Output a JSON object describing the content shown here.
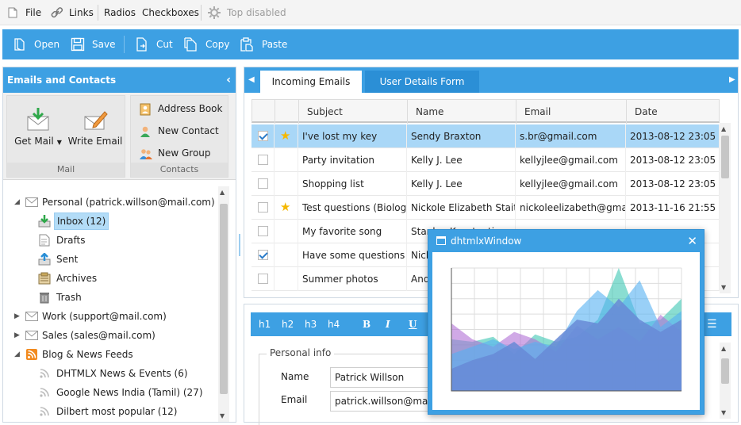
{
  "menubar": {
    "file": "File",
    "links": "Links",
    "radios": "Radios",
    "checkboxes": "Checkboxes",
    "top_disabled": "Top disabled"
  },
  "toolbar": {
    "open": "Open",
    "save": "Save",
    "cut": "Cut",
    "copy": "Copy",
    "paste": "Paste"
  },
  "left_panel": {
    "title": "Emails and Contacts",
    "ribbon": {
      "mail_group": "Mail",
      "contacts_group": "Contacts",
      "get_mail": "Get Mail",
      "write_email": "Write Email",
      "address_book": "Address Book",
      "new_contact": "New Contact",
      "new_group": "New Group"
    },
    "tree": [
      {
        "label": "Personal (patrick.willson@mail.com)"
      },
      {
        "label": "Inbox (12)"
      },
      {
        "label": "Drafts"
      },
      {
        "label": "Sent"
      },
      {
        "label": "Archives"
      },
      {
        "label": "Trash"
      },
      {
        "label": "Work (support@mail.com)"
      },
      {
        "label": "Sales (sales@mail.com)"
      },
      {
        "label": "Blog & News Feeds"
      },
      {
        "label": "DHTMLX News & Events (6)"
      },
      {
        "label": "Google News India (Tamil) (27)"
      },
      {
        "label": "Dilbert most popular (12)"
      }
    ]
  },
  "tabs": {
    "incoming": "Incoming Emails",
    "user_form": "User Details Form"
  },
  "grid": {
    "columns": [
      "Subject",
      "Name",
      "Email",
      "Date"
    ],
    "rows": [
      {
        "checked": true,
        "starred": true,
        "subject": "I've lost my key",
        "name": "Sendy Braxton",
        "email": "s.br@gmail.com",
        "date": "2013-08-12 23:05",
        "selected": true
      },
      {
        "checked": false,
        "starred": false,
        "subject": "Party invitation",
        "name": "Kelly J. Lee",
        "email": "kellyjlee@gmail.com",
        "date": "2013-08-12 23:05",
        "selected": false
      },
      {
        "checked": false,
        "starred": false,
        "subject": "Shopping list",
        "name": "Kelly J. Lee",
        "email": "kellyjlee@gmail.com",
        "date": "2013-08-12 23:05",
        "selected": false
      },
      {
        "checked": false,
        "starred": true,
        "subject": "Test questions (Biology)",
        "name": "Nickole Elizabeth Staitman",
        "email": "nickoleelizabeth@gmail.com",
        "date": "2013-11-16 21:55",
        "selected": false
      },
      {
        "checked": false,
        "starred": false,
        "subject": "My favorite song",
        "name": "Stanley Konstantine",
        "email": "",
        "date": "",
        "selected": false
      },
      {
        "checked": true,
        "starred": false,
        "subject": "Have some questions",
        "name": "Nickole Elizabeth",
        "email": "",
        "date": "",
        "selected": false
      },
      {
        "checked": false,
        "starred": false,
        "subject": "Summer photos",
        "name": "Andrew",
        "email": "",
        "date": "",
        "selected": false
      }
    ]
  },
  "editor": {
    "buttons": [
      "h1",
      "h2",
      "h3",
      "h4",
      "B",
      "I",
      "U"
    ],
    "fieldset_legend": "Personal info",
    "name_label": "Name",
    "name_value": "Patrick Willson",
    "email_label": "Email",
    "email_value": "patrick.willson@mail.com"
  },
  "window": {
    "title": "dhtmlxWindow",
    "close": "✕"
  },
  "chart_data": {
    "type": "area",
    "title": "",
    "xlabel": "",
    "ylabel": "",
    "x": [
      0,
      1,
      2,
      3,
      4,
      5,
      6,
      7,
      8,
      9
    ],
    "ylim": [
      0,
      100
    ],
    "grid": true,
    "series": [
      {
        "color": "#3cc7b2",
        "values": [
          42,
          40,
          44,
          30,
          46,
          40,
          44,
          58,
          100,
          55,
          58,
          75
        ]
      },
      {
        "color": "#b16fd6",
        "values": [
          55,
          42,
          36,
          48,
          42,
          32,
          53,
          42,
          52,
          40,
          62,
          48
        ]
      },
      {
        "color": "#55b1f2",
        "values": [
          30,
          36,
          42,
          34,
          40,
          36,
          65,
          82,
          68,
          90,
          52,
          65
        ]
      },
      {
        "color": "#6789d6",
        "values": [
          18,
          25,
          30,
          40,
          26,
          42,
          58,
          55,
          75,
          58,
          48,
          58
        ]
      }
    ]
  },
  "colors": {
    "accent": "#3da0e3",
    "selection": "#a9d7f7"
  }
}
